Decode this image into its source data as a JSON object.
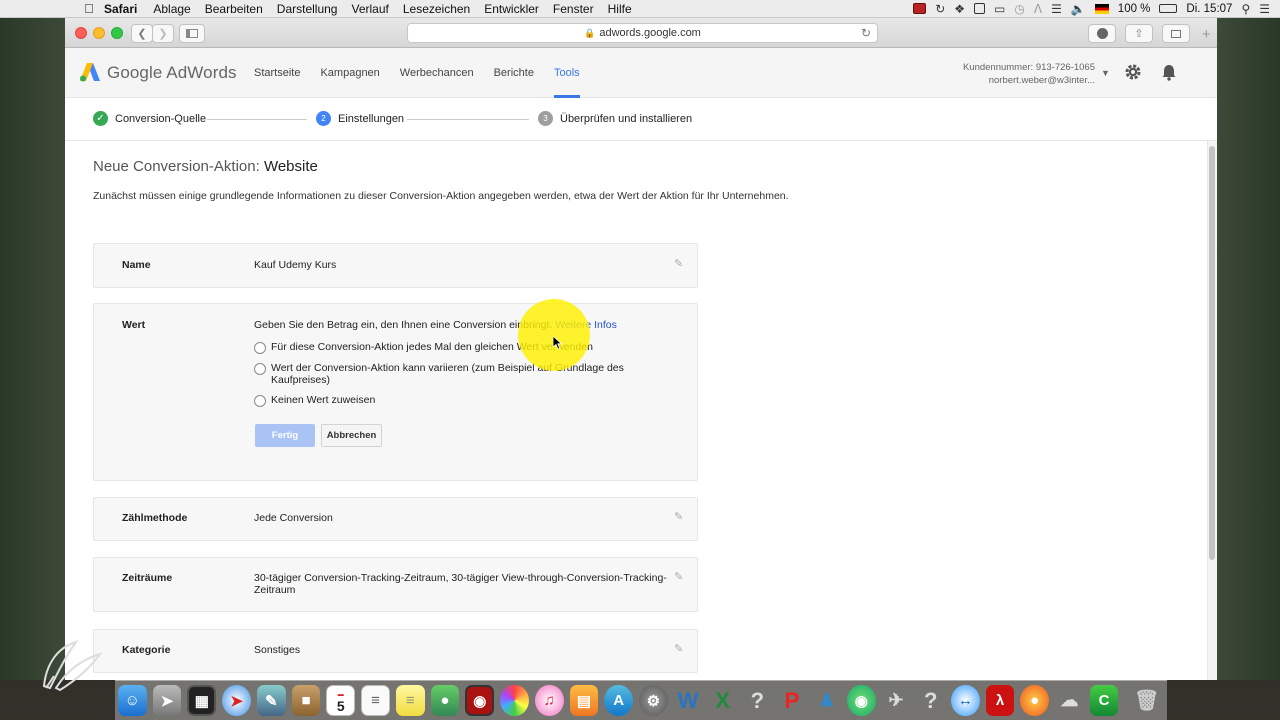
{
  "menubar": {
    "app": "Safari",
    "items": [
      "Ablage",
      "Bearbeiten",
      "Darstellung",
      "Verlauf",
      "Lesezeichen",
      "Entwickler",
      "Fenster",
      "Hilfe"
    ],
    "battery": "100 %",
    "clock": "Di. 15:07"
  },
  "browser": {
    "url": "adwords.google.com"
  },
  "adwords": {
    "brand": "Google AdWords",
    "nav": [
      "Startseite",
      "Kampagnen",
      "Werbechancen",
      "Berichte",
      "Tools"
    ],
    "active_nav": "Tools",
    "customer_number": "Kundennummer: 913-726-1065",
    "account_email": "norbert.weber@w3inter..."
  },
  "stepper": {
    "steps": [
      {
        "number": "",
        "label": "Conversion-Quelle",
        "state": "done"
      },
      {
        "number": "2",
        "label": "Einstellungen",
        "state": "active"
      },
      {
        "number": "3",
        "label": "Überprüfen und installieren",
        "state": "pending"
      }
    ]
  },
  "page": {
    "title_prefix": "Neue Conversion-Aktion:",
    "title_emph": "Website",
    "intro": "Zunächst müssen einige grundlegende Informationen zu dieser Conversion-Aktion angegeben werden, etwa der Wert der Aktion für Ihr Unternehmen."
  },
  "cards": {
    "name": {
      "label": "Name",
      "value": "Kauf Udemy Kurs"
    },
    "wert": {
      "label": "Wert",
      "hint": "Geben Sie den Betrag ein, den Ihnen eine Conversion einbringt.",
      "more_link": "Weitere Infos",
      "options": [
        "Für diese Conversion-Aktion jedes Mal den gleichen Wert verwenden",
        "Wert der Conversion-Aktion kann variieren (zum Beispiel auf Grundlage des",
        "Kaufpreises)",
        "Keinen Wert zuweisen"
      ],
      "done_label": "Fertig",
      "cancel_label": "Abbrechen"
    },
    "count": {
      "label": "Zählmethode",
      "value": "Jede Conversion"
    },
    "windows": {
      "label": "Zeiträume",
      "value_line1": "30-tägiger Conversion-Tracking-Zeitraum, 30-tägiger View-through-Conversion-Tracking-",
      "value_line2": "Zeitraum"
    },
    "category": {
      "label": "Kategorie",
      "value": "Sonstiges"
    }
  },
  "colors": {
    "accent": "#3b78e7",
    "done_green": "#34a853",
    "highlight": "#fff000"
  },
  "dock": {
    "calendar_day": "5"
  }
}
